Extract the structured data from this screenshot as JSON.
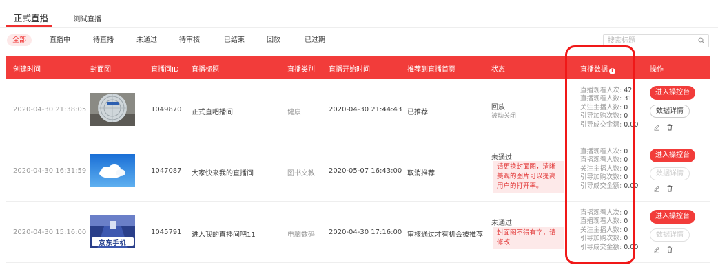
{
  "tabs": [
    {
      "label": "正式直播",
      "active": true
    },
    {
      "label": "测试直播",
      "active": false
    }
  ],
  "filters": [
    "全部",
    "直播中",
    "待直播",
    "未通过",
    "待审核",
    "已结束",
    "回放",
    "已过期"
  ],
  "search": {
    "placeholder": "搜索标题"
  },
  "headers": {
    "created": "创建时间",
    "cover": "封面图",
    "room_id": "直播间ID",
    "title": "直播标题",
    "category": "直播类别",
    "start_time": "直播开始时间",
    "recommend": "推荐到直播首页",
    "status": "状态",
    "data": "直播数据",
    "info": "i",
    "ops": "操作"
  },
  "stat_labels": [
    "直播观看人次: ",
    "直播观看人数: ",
    "关注主播人数: ",
    "引导加购次数: ",
    "引导成交金额: "
  ],
  "rows": [
    {
      "created": "2020-04-30 21:38:05",
      "room_id": "1049870",
      "title": "正式直吧播间",
      "category": "健康",
      "start_time": "2020-04-30 21:44:43",
      "recommend": "已推荐",
      "status": "回放",
      "status_sub": "被动关闭",
      "reason": "",
      "stats": [
        "42",
        "31",
        "0",
        "0",
        "0.00"
      ],
      "enter_label": "进入操控台",
      "detail_label": "数据详情",
      "detail_enabled": true
    },
    {
      "created": "2020-04-30 16:31:59",
      "room_id": "1047087",
      "title": "大家快来我的直播间",
      "category": "图书文教",
      "start_time": "2020-05-07 16:43:00",
      "recommend": "取消推荐",
      "status": "未通过",
      "status_sub": "",
      "reason": "请更换封面图，清晰美观的图片可以提高用户的打开率。",
      "stats": [
        "0",
        "0",
        "0",
        "0",
        "0.00"
      ],
      "enter_label": "进入操控台",
      "detail_label": "数据详情",
      "detail_enabled": false
    },
    {
      "created": "2020-04-30 15:16:00",
      "room_id": "1045791",
      "title": "进入我的直播间吧11",
      "category": "电脑数码",
      "start_time": "2020-04-30 17:16:00",
      "recommend": "审核通过才有机会被推荐",
      "status": "未通过",
      "status_sub": "",
      "reason": "封面图不得有字，请修改",
      "stats": [
        "0",
        "0",
        "0",
        "0",
        "0.00"
      ],
      "enter_label": "进入操控台",
      "detail_label": "数据详情",
      "detail_enabled": false
    }
  ],
  "thumb_text": [
    "",
    "",
    "京东手机"
  ],
  "colors": {
    "accent": "#f23c3a",
    "highlight": "#f01818"
  }
}
